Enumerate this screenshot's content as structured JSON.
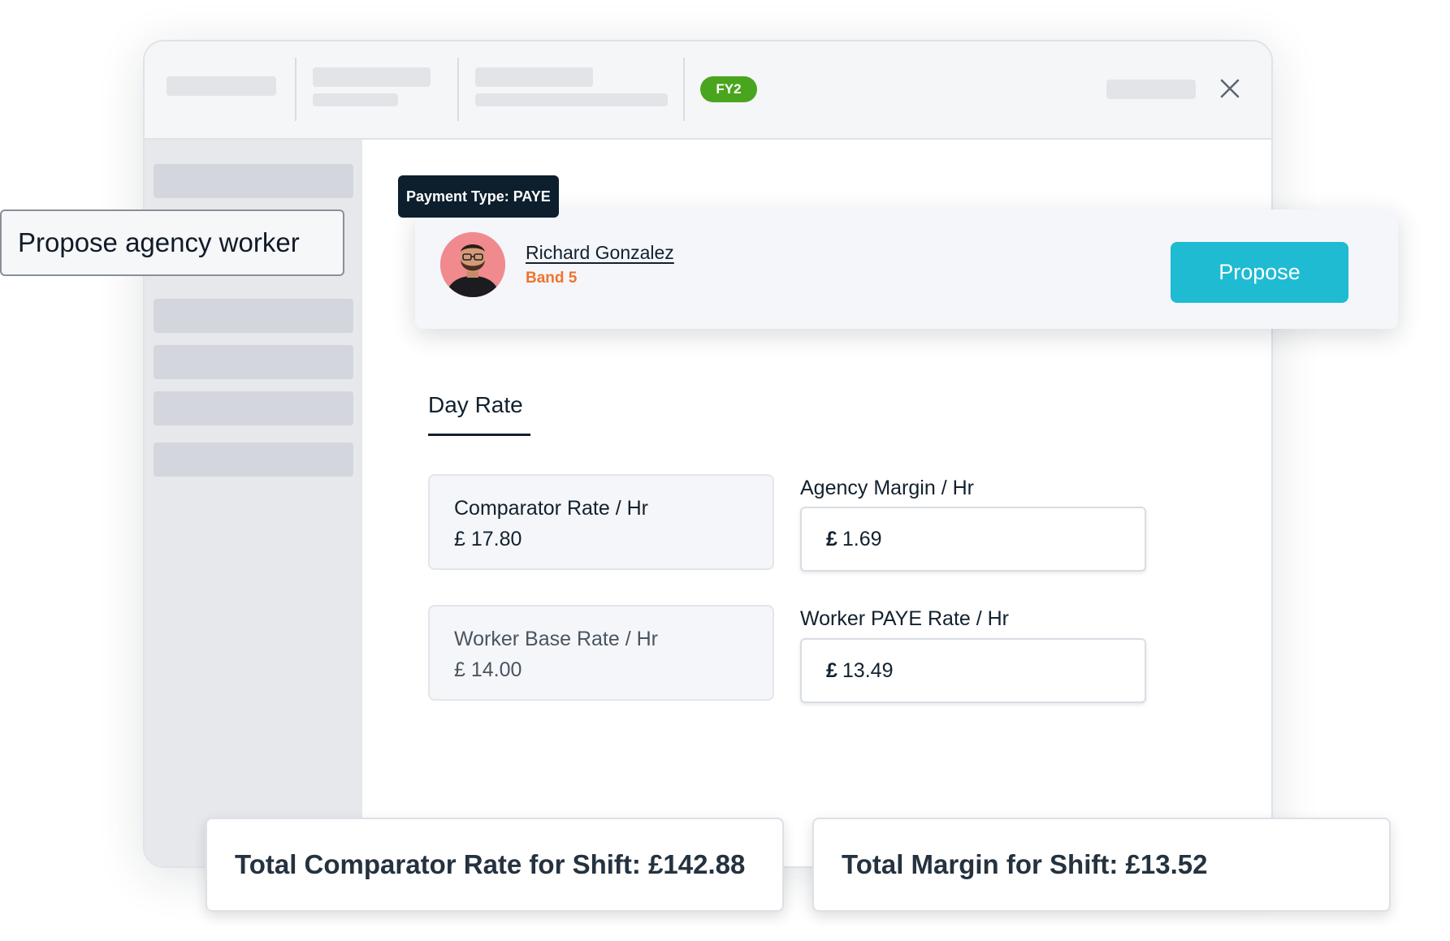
{
  "header": {
    "fy_badge": "FY2",
    "close_icon": "close-icon"
  },
  "callout": {
    "label": "Propose agency worker"
  },
  "worker": {
    "payment_type": "Payment Type: PAYE",
    "name": "Richard Gonzalez",
    "band": "Band 5",
    "propose_label": "Propose"
  },
  "tabs": {
    "active": "Day Rate"
  },
  "rates": {
    "comparator": {
      "label": "Comparator Rate / Hr",
      "value": "£ 17.80"
    },
    "worker_base": {
      "label": "Worker Base Rate / Hr",
      "value": "£ 14.00"
    },
    "agency_margin": {
      "label": "Agency Margin / Hr",
      "currency": "£",
      "value": "1.69"
    },
    "worker_paye": {
      "label": "Worker PAYE Rate / Hr",
      "currency": "£",
      "value": "13.49"
    }
  },
  "totals": {
    "comparator": "Total Comparator Rate for Shift: £142.88",
    "margin": "Total Margin for Shift: £13.52"
  },
  "colors": {
    "accent": "#1ebbd3",
    "fy_badge": "#49a51d",
    "band": "#f0732c",
    "tag_bg": "#0d1f2d"
  }
}
